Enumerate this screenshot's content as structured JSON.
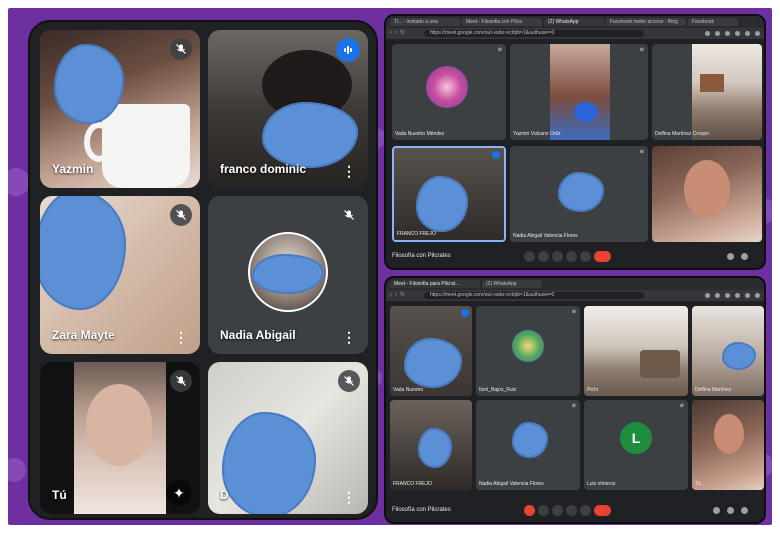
{
  "phone": {
    "tiles": [
      {
        "name": "Yazmin",
        "muted": true,
        "more": "⋮"
      },
      {
        "name": "franco dominic",
        "speaking": true,
        "more": "⋮"
      },
      {
        "name": "Zara Mayte",
        "muted": true,
        "more": "⋮"
      },
      {
        "name": "Nadia Abigail",
        "muted": true,
        "more": "⋮"
      },
      {
        "name": "Tú",
        "muted": true
      },
      {
        "name": "D",
        "muted": true,
        "more": "⋮"
      }
    ]
  },
  "browser_top": {
    "tabs": [
      "Ti... · invitado a una",
      "Meet - Filosofia con Pilca",
      "(2) WhatsApp",
      "Facebook meter acceso · Bing",
      "Facebook"
    ],
    "url": "https://meet.google.com/out-vwbz-nct/pb=1&authuser=0",
    "meeting_name": "Filosofía con Pilcrates",
    "tiles": [
      {
        "label": "Vada Nuestro Méndez"
      },
      {
        "label": "Yazmin Vulcano Ortiz"
      },
      {
        "label": "Delfina Martínez Crespo"
      },
      {
        "label": "FRANCO FREJO"
      },
      {
        "label": "Nadia Abigail Valencia Flores"
      },
      {
        "label": ""
      }
    ]
  },
  "browser_bottom": {
    "tabs": [
      "Meet - Filosofía para Pilcrat...",
      "(2) WhatsApp"
    ],
    "url": "https://meet.google.com/out-vwbz-nct/pb=1&authuser=0",
    "meeting_name": "Filosofía con Pilcrates",
    "tiles": [
      {
        "label": "Vada Nuestro"
      },
      {
        "label": "Itzel_Bajos_Ruiz"
      },
      {
        "label": "Pichi"
      },
      {
        "label": "Delfina Martínez"
      },
      {
        "label": "FRANCO FREJO"
      },
      {
        "label": "Nadia Abigail Valencia Flores"
      },
      {
        "label": "Luis olmeros",
        "initial": "L"
      },
      {
        "label": "Tú"
      }
    ]
  },
  "colors": {
    "background_purple": "#6e2fa0",
    "meet_dark": "#202124",
    "tile_dark": "#3c4043",
    "blur_blue": "#5b8fd6",
    "speaking_blue": "#1a73e8",
    "end_call_red": "#ea4335",
    "avatar_green": "#1e8e3e"
  }
}
